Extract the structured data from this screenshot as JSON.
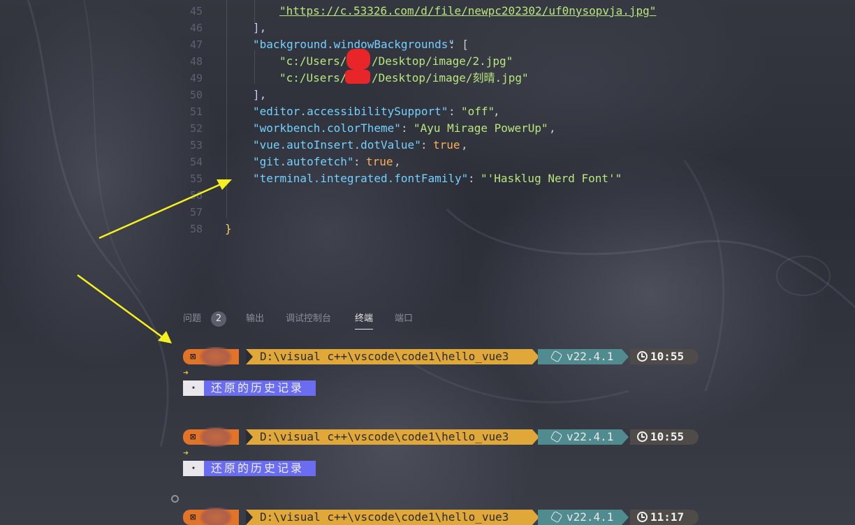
{
  "editor": {
    "lines": [
      {
        "num": "45"
      },
      {
        "num": "46"
      },
      {
        "num": "47"
      },
      {
        "num": "48"
      },
      {
        "num": "49"
      },
      {
        "num": "50"
      },
      {
        "num": "51"
      },
      {
        "num": "52"
      },
      {
        "num": "53"
      },
      {
        "num": "54"
      },
      {
        "num": "55"
      },
      {
        "num": "56"
      },
      {
        "num": "57"
      },
      {
        "num": "58"
      }
    ],
    "l45_url": "\"https://c.53326.com/d/file/newpc202302/uf0nysopvja.jpg\"",
    "l46": "],",
    "l47_key": "\"background.windowBackgrounds\"",
    "l47_rest": ": [",
    "l48_a": "\"c:/Users/",
    "l48_b": "/Desktop/image/2.jpg\"",
    "l49_a": "\"c:/Users/",
    "l49_b": "/Desktop/image/刻晴.jpg\"",
    "l50": "],",
    "l51_key": "\"editor.accessibilitySupport\"",
    "l51_val": "\"off\"",
    "l52_key": "\"workbench.colorTheme\"",
    "l52_val": "\"Ayu Mirage PowerUp\"",
    "l53_key": "\"vue.autoInsert.dotValue\"",
    "l53_val": "true",
    "l54_key": "\"git.autofetch\"",
    "l54_val": "true",
    "l55_key": "\"terminal.integrated.fontFamily\"",
    "l55_val": "\"'Hasklug Nerd Font'\"",
    "l58": "}"
  },
  "panel": {
    "tabs": [
      {
        "label": "问题"
      },
      {
        "label": "输出"
      },
      {
        "label": "调试控制台"
      },
      {
        "label": "终端"
      },
      {
        "label": "端口"
      }
    ],
    "problems_count": "2",
    "active_tab": "终端"
  },
  "terminal": {
    "prompts": [
      {
        "path": "D:\\visual c++\\vscode\\code1\\hello_vue3",
        "node": "v22.4.1",
        "time": "10:55",
        "history": "还原的历史记录"
      },
      {
        "path": "D:\\visual c++\\vscode\\code1\\hello_vue3",
        "node": "v22.4.1",
        "time": "10:55",
        "history": "还原的历史记录"
      },
      {
        "path": "D:\\visual c++\\vscode\\code1\\hello_vue3",
        "node": "v22.4.1",
        "time": "11:17"
      }
    ],
    "user_glyph": "⊠",
    "star": "⋆",
    "cursor": "➜"
  },
  "colors": {
    "seg_user": "#e2742a",
    "seg_path": "#e0a838",
    "seg_node": "#4f8b8f",
    "seg_time": "#4e4b49",
    "history_bg": "#6a6cf2",
    "annotation_arrow": "#f5f01e"
  }
}
